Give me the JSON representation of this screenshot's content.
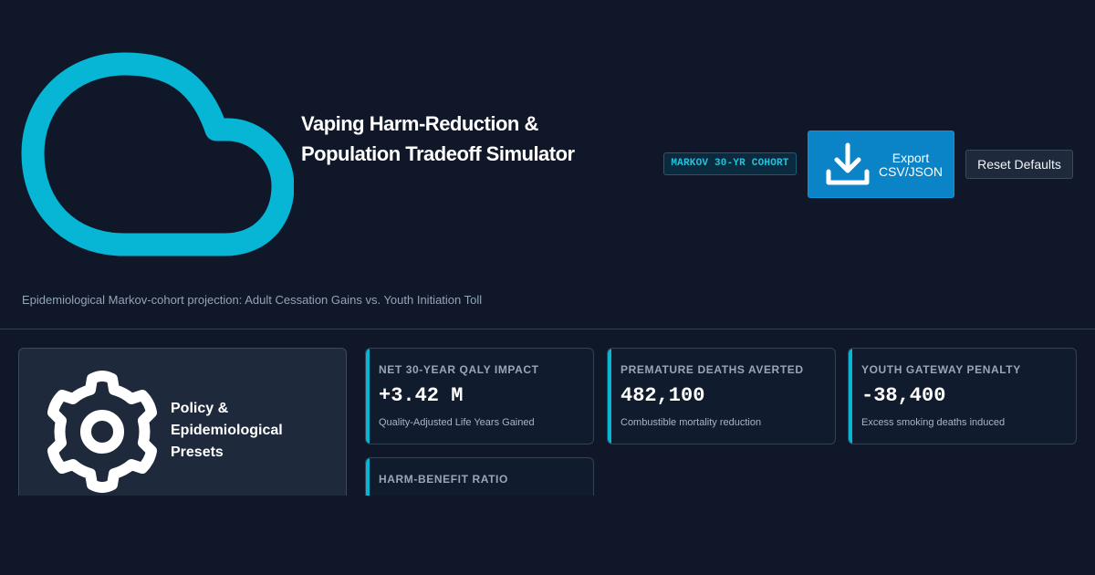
{
  "header": {
    "logo_icon": "cloud-icon",
    "title": "Vaping Harm-Reduction & Population Tradeoff Simulator",
    "badge": "MARKOV 30-YR COHORT",
    "export_button": {
      "icon": "download-icon",
      "label": "Export CSV/JSON"
    },
    "reset_button": {
      "label": "Reset Defaults"
    },
    "subtitle": "Epidemiological Markov-cohort projection: Adult Cessation Gains vs. Youth Initiation Toll"
  },
  "presets_panel": {
    "icon": "gear-icon",
    "title": "Policy & Epidemiological Presets"
  },
  "kpis": [
    {
      "label": "NET 30-YEAR QALY IMPACT",
      "value": "+3.42 M",
      "description": "Quality-Adjusted Life Years Gained"
    },
    {
      "label": "PREMATURE DEATHS AVERTED",
      "value": "482,100",
      "description": "Combustible mortality reduction"
    },
    {
      "label": "YOUTH GATEWAY PENALTY",
      "value": "-38,400",
      "description": "Excess smoking deaths induced"
    },
    {
      "label": "HARM-BENEFIT RATIO",
      "value": "",
      "description": ""
    }
  ],
  "colors": {
    "background": "#0f1729",
    "accent": "#06b6d4",
    "primary_button": "#0a84c6",
    "panel": "#1e293b"
  }
}
